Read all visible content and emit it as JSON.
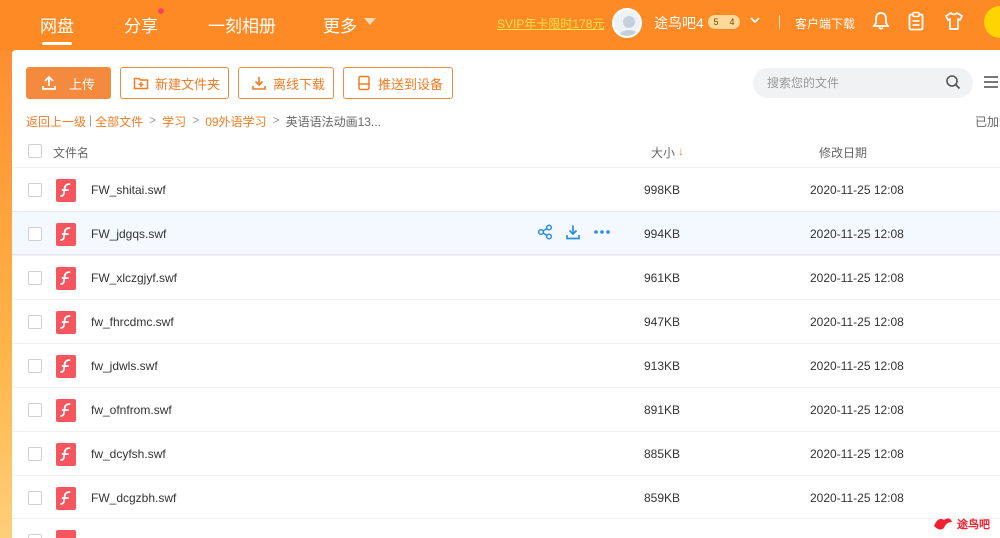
{
  "nav": {
    "items": [
      {
        "label": "网盘",
        "active": true
      },
      {
        "label": "分享",
        "active": false
      },
      {
        "label": "一刻相册",
        "active": false
      },
      {
        "label": "更多",
        "active": false
      }
    ],
    "svip_promo": "SVIP年卡限时178元",
    "username": "途鸟吧4",
    "badge_level": "5",
    "badge_count": "4",
    "client_download": "客户端下载"
  },
  "toolbar": {
    "upload": "上传",
    "new_folder": "新建文件夹",
    "offline_download": "离线下载",
    "push_device": "推送到设备",
    "search_placeholder": "搜索您的文件"
  },
  "breadcrumb": {
    "back": "返回上一级",
    "items": [
      "全部文件",
      "学习",
      "09外语学习"
    ],
    "current": "英语语法动画13...",
    "loaded": "已加载"
  },
  "table": {
    "col_name": "文件名",
    "col_size": "大小",
    "col_size_sort": "↓",
    "col_date": "修改日期",
    "rows": [
      {
        "name": "FW_shitai.swf",
        "size": "998KB",
        "date": "2020-11-25 12:08"
      },
      {
        "name": "FW_jdgqs.swf",
        "size": "994KB",
        "date": "2020-11-25 12:08"
      },
      {
        "name": "FW_xlczgjyf.swf",
        "size": "961KB",
        "date": "2020-11-25 12:08"
      },
      {
        "name": "fw_fhrcdmc.swf",
        "size": "947KB",
        "date": "2020-11-25 12:08"
      },
      {
        "name": "fw_jdwls.swf",
        "size": "913KB",
        "date": "2020-11-25 12:08"
      },
      {
        "name": "fw_ofnfrom.swf",
        "size": "891KB",
        "date": "2020-11-25 12:08"
      },
      {
        "name": "fw_dcyfsh.swf",
        "size": "885KB",
        "date": "2020-11-25 12:08"
      },
      {
        "name": "FW_dcgzbh.swf",
        "size": "859KB",
        "date": "2020-11-25 12:08"
      }
    ]
  },
  "watermark": "途鸟吧",
  "colors": {
    "nav_bg": "#fd8a25",
    "accent": "#f07b22",
    "file_icon": "#f5555d",
    "action_icon": "#2b8fd8"
  }
}
